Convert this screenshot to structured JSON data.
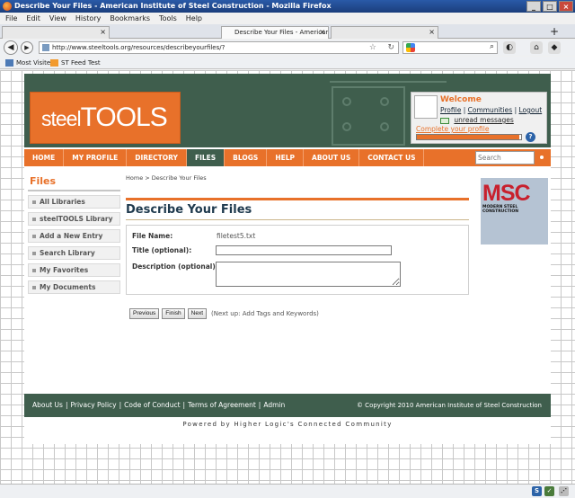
{
  "window": {
    "title": "Describe Your Files - American Institute of Steel Construction - Mozilla Firefox"
  },
  "menubar": [
    "File",
    "Edit",
    "View",
    "History",
    "Bookmarks",
    "Tools",
    "Help"
  ],
  "tabs": [
    {
      "label": ""
    },
    {
      "label": "Describe Your Files - American I..."
    },
    {
      "label": ""
    }
  ],
  "nav": {
    "url": "http://www.steeltools.org/resources/describeyourfiles/?",
    "new_tab": "+"
  },
  "bookmarks": [
    {
      "label": "Most Visited"
    },
    {
      "label": "ST Feed Test"
    }
  ],
  "header": {
    "logo_steel": "steel",
    "logo_tools": "TOOLS",
    "welcome": {
      "title": "Welcome",
      "profile": "Profile",
      "communities": "Communities",
      "logout": "Logout",
      "unread": "unread messages",
      "complete_profile": "Complete your profile",
      "progress": 0.98
    }
  },
  "mainnav": {
    "items": [
      "HOME",
      "MY PROFILE",
      "DIRECTORY",
      "FILES",
      "BLOGS",
      "HELP",
      "ABOUT US",
      "CONTACT US"
    ],
    "active": "FILES",
    "search_placeholder": "Search"
  },
  "sidebar": {
    "title": "Files",
    "items": [
      "All Libraries",
      "steelTOOLS Library",
      "Add a New Entry",
      "Search Library",
      "My Favorites",
      "My Documents"
    ]
  },
  "main": {
    "breadcrumb": "Home > Describe Your Files",
    "title": "Describe Your Files",
    "form": {
      "file_name_label": "File Name:",
      "file_name_value": "filetest5.txt",
      "title_label": "Title (optional):",
      "title_value": "",
      "description_label": "Description (optional):",
      "description_value": ""
    },
    "buttons": {
      "previous": "Previous",
      "finish": "Finish",
      "next": "Next"
    },
    "next_note": "(Next up: Add Tags and Keywords)"
  },
  "ad": {
    "brand": "MSC",
    "subtitle": "MODERN STEEL CONSTRUCTION"
  },
  "footer": {
    "links": [
      "About Us",
      "Privacy Policy",
      "Code of Conduct",
      "Terms of Agreement",
      "Admin"
    ],
    "copyright": "© Copyright 2010 American Institute of Steel Construction",
    "powered": "Powered by Higher Logic's Connected Community"
  },
  "colors": {
    "orange": "#e8712a",
    "green": "#3f5e4d",
    "title_blue": "#1f3a4e"
  }
}
